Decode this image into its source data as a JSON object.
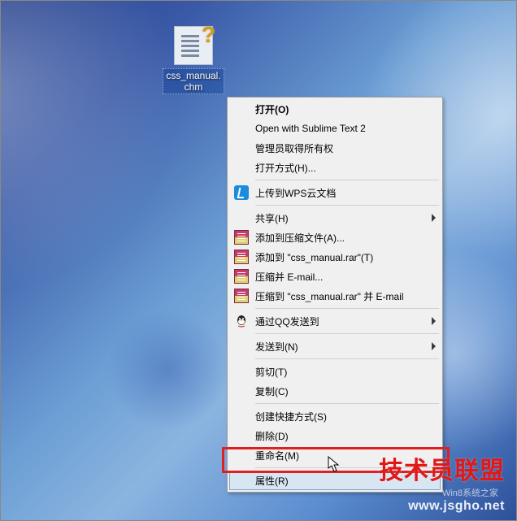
{
  "desktop_icon": {
    "label": "css_manual.chm"
  },
  "menu": {
    "open": "打开(O)",
    "open_sublime": "Open with Sublime Text 2",
    "admin_take": "管理员取得所有权",
    "open_with": "打开方式(H)...",
    "wps_upload": "上传到WPS云文档",
    "share": "共享(H)",
    "rar_add": "添加到压缩文件(A)...",
    "rar_add_name": "添加到 \"css_manual.rar\"(T)",
    "rar_email": "压缩并 E-mail...",
    "rar_email_name": "压缩到 \"css_manual.rar\" 并 E-mail",
    "qq_send": "通过QQ发送到",
    "send_to": "发送到(N)",
    "cut": "剪切(T)",
    "copy": "复制(C)",
    "shortcut": "创建快捷方式(S)",
    "delete": "删除(D)",
    "rename": "重命名(M)",
    "properties": "属性(R)"
  },
  "watermark": {
    "red": "技术员联盟",
    "sub": "Win8系统之家",
    "url": "www.jsgho.net"
  }
}
